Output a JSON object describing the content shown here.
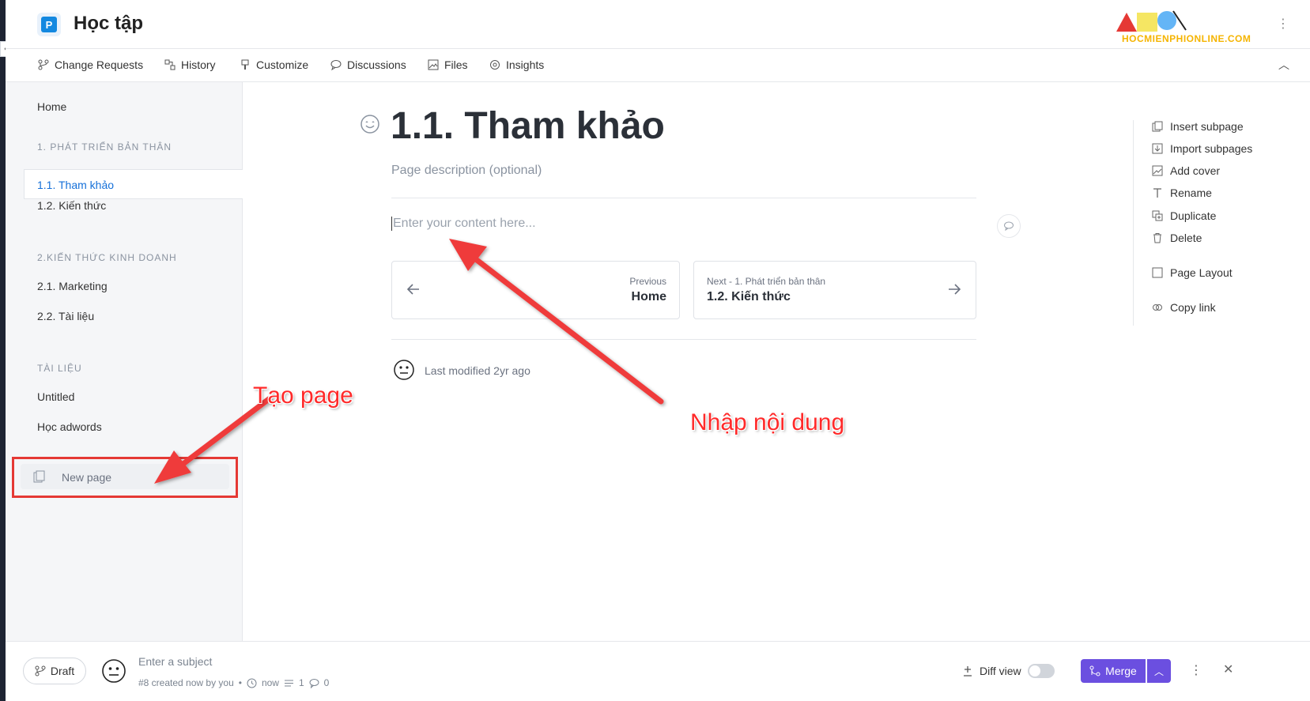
{
  "header": {
    "space_title": "Học tập",
    "logo_letter": "P",
    "brand_text": "HOCMIENPHIONLINE.COM"
  },
  "tabs": [
    {
      "label": "Change Requests",
      "icon": "branch-icon"
    },
    {
      "label": "History",
      "icon": "history-icon"
    },
    {
      "label": "Customize",
      "icon": "brush-icon"
    },
    {
      "label": "Discussions",
      "icon": "chat-icon"
    },
    {
      "label": "Files",
      "icon": "image-icon"
    },
    {
      "label": "Insights",
      "icon": "insights-icon"
    }
  ],
  "sidebar": {
    "home": "Home",
    "section1": {
      "heading": "1. PHÁT TRIỂN BẢN THÂN",
      "items": [
        "1.1. Tham khảo",
        "1.2. Kiến thức"
      ]
    },
    "section2": {
      "heading": "2.KIẾN THỨC KINH DOANH",
      "items": [
        "2.1. Marketing",
        "2.2. Tài liệu"
      ]
    },
    "section3": {
      "heading": "TÀI LIỆU",
      "items": [
        "Untitled",
        "Học adwords"
      ]
    },
    "new_page": "New page"
  },
  "page": {
    "title": "1.1. Tham khảo",
    "description_placeholder": "Page description (optional)",
    "content_placeholder": "Enter your content here...",
    "prev_label": "Previous",
    "prev_title": "Home",
    "next_label": "Next - 1. Phát triển bản thân",
    "next_title": "1.2. Kiến thức",
    "last_modified": "Last modified 2yr ago"
  },
  "actions": [
    {
      "label": "Insert subpage",
      "icon": "insert-subpage-icon"
    },
    {
      "label": "Import subpages",
      "icon": "import-icon"
    },
    {
      "label": "Add cover",
      "icon": "cover-icon"
    },
    {
      "label": "Rename",
      "icon": "text-icon"
    },
    {
      "label": "Duplicate",
      "icon": "duplicate-icon"
    },
    {
      "label": "Delete",
      "icon": "trash-icon"
    },
    {
      "label": "Page Layout",
      "icon": "layout-icon"
    },
    {
      "label": "Copy link",
      "icon": "link-icon"
    }
  ],
  "bottom": {
    "draft_label": "Draft",
    "subject_placeholder": "Enter a subject",
    "created_text": "#8 created now by you",
    "time_text": "now",
    "changes_count": "1",
    "comments_count": "0",
    "diff_view_label": "Diff view",
    "merge_label": "Merge"
  },
  "annotations": {
    "create_page": "Tạo page",
    "enter_content": "Nhập nội dung"
  },
  "colors": {
    "accent": "#1570d9",
    "merge": "#6b4fe0",
    "annotation": "#ff2a2a"
  }
}
